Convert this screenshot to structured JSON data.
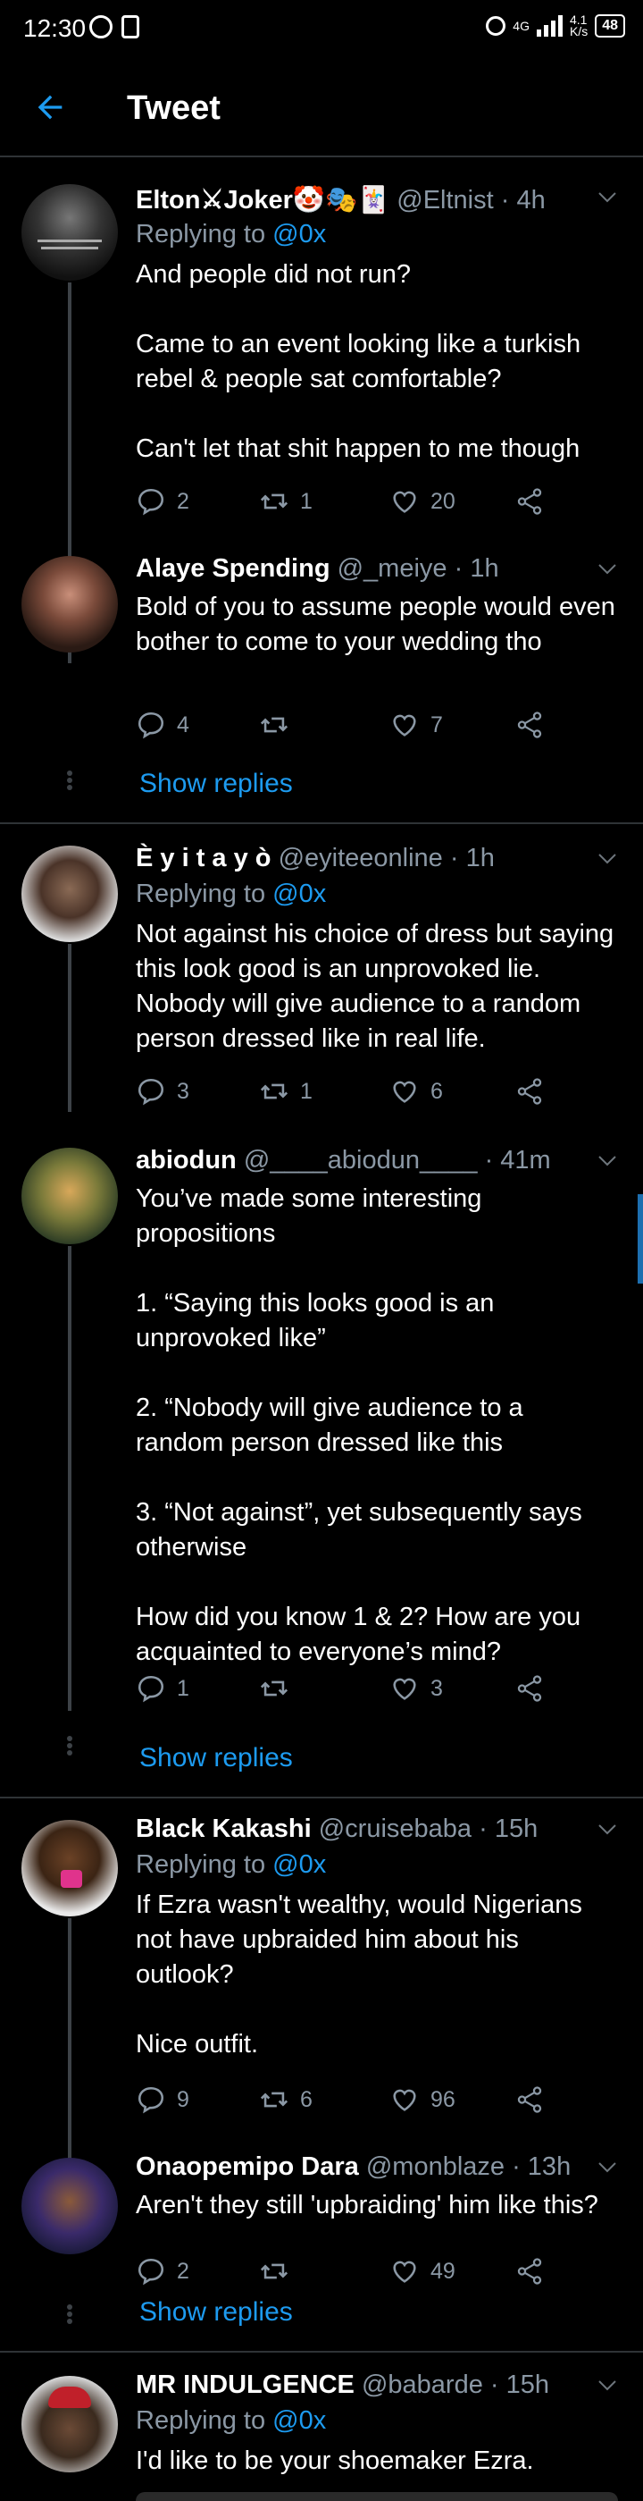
{
  "status_bar": {
    "time": "12:30",
    "network": "4G",
    "speed": "4.1\nK/s",
    "battery": "48"
  },
  "header": {
    "title": "Tweet"
  },
  "tweets": [
    {
      "name": "Elton⚔Joker🤡🎭🃏",
      "handle": "@Eltnist",
      "time": "· 4h",
      "replying_prefix": "Replying to",
      "replying_to": "@0x",
      "text": "And people did not run?\n\nCame to an event looking like a turkish rebel & people sat comfortable?\n\nCan't let that shit happen to me though",
      "replies": "2",
      "retweets": "1",
      "likes": "20"
    },
    {
      "name": "Alaye Spending",
      "handle": "@_meiye",
      "time": "· 1h",
      "text": "Bold of you to assume people would even bother to come to your wedding tho",
      "replies": "4",
      "retweets": "",
      "likes": "7",
      "show_replies": "Show replies"
    },
    {
      "name": "È y i t a y ò",
      "handle": "@eyiteeonline",
      "time": "· 1h",
      "replying_prefix": "Replying to",
      "replying_to": "@0x",
      "text": "Not against his choice of dress but saying this look good is an unprovoked lie. Nobody will give audience to a random person dressed like in real life.",
      "replies": "3",
      "retweets": "1",
      "likes": "6"
    },
    {
      "name": "abiodun",
      "handle": "@____abiodun____",
      "time": "· 41m",
      "text": "You’ve made some interesting propositions\n\n1. “Saying this looks good is an unprovoked like”\n\n2. “Nobody will give audience to a random person dressed like this\n\n3. “Not against”, yet subsequently says otherwise\n\nHow did you know 1 & 2? How are you acquainted to everyone’s mind?",
      "replies": "1",
      "retweets": "",
      "likes": "3",
      "show_replies": "Show replies"
    },
    {
      "name": "Black Kakashi",
      "handle": "@cruisebaba",
      "time": "· 15h",
      "replying_prefix": "Replying to",
      "replying_to": "@0x",
      "text": "If Ezra wasn't wealthy, would Nigerians not have upbraided him about his outlook?\n\nNice outfit.",
      "replies": "9",
      "retweets": "6",
      "likes": "96"
    },
    {
      "name": "Onaopemipo Dara",
      "handle": "@monblaze",
      "time": "· 13h",
      "text": "Aren't they still 'upbraiding' him like this?",
      "replies": "2",
      "retweets": "",
      "likes": "49",
      "show_replies": "Show replies"
    },
    {
      "name": "MR INDULGENCE",
      "handle": "@babarde",
      "time": "· 15h",
      "replying_prefix": "Replying to",
      "replying_to": "@0x",
      "text": "I'd like to be your shoemaker Ezra."
    }
  ]
}
